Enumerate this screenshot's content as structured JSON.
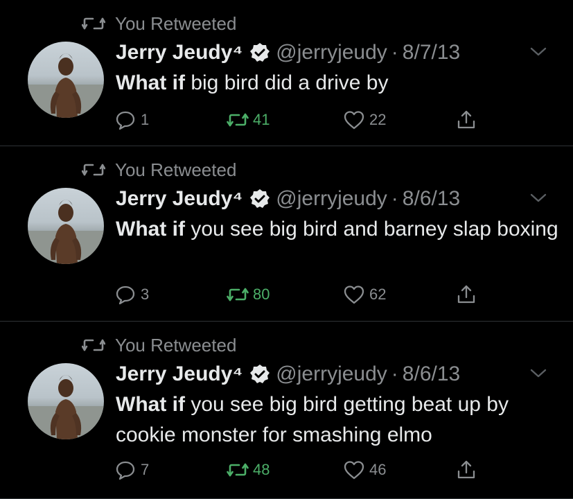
{
  "colors": {
    "background": "#000000",
    "primary_text": "#e7e9ea",
    "secondary_text": "#8b8e91",
    "retweet_green": "#4caf68",
    "divider": "#2f3336"
  },
  "tweets": [
    {
      "retweet_label": "You Retweeted",
      "author_name": "Jerry Jeudy⁴",
      "verified_icon": "verified-badge-icon",
      "handle": "@jerryjeudy",
      "separator": "·",
      "date": "8/7/13",
      "text_bold": "What if",
      "text_rest": " big bird did a drive by",
      "replies": "1",
      "retweets": "41",
      "likes": "22"
    },
    {
      "retweet_label": "You Retweeted",
      "author_name": "Jerry Jeudy⁴",
      "verified_icon": "verified-badge-icon",
      "handle": "@jerryjeudy",
      "separator": "·",
      "date": "8/6/13",
      "text_bold": "What if",
      "text_rest": " you see big bird and barney slap boxing",
      "replies": "3",
      "retweets": "80",
      "likes": "62"
    },
    {
      "retweet_label": "You Retweeted",
      "author_name": "Jerry Jeudy⁴",
      "verified_icon": "verified-badge-icon",
      "handle": "@jerryjeudy",
      "separator": "·",
      "date": "8/6/13",
      "text_bold": "What if",
      "text_rest": " you see big bird getting beat up by cookie monster for smashing elmo",
      "replies": "7",
      "retweets": "48",
      "likes": "46"
    }
  ]
}
